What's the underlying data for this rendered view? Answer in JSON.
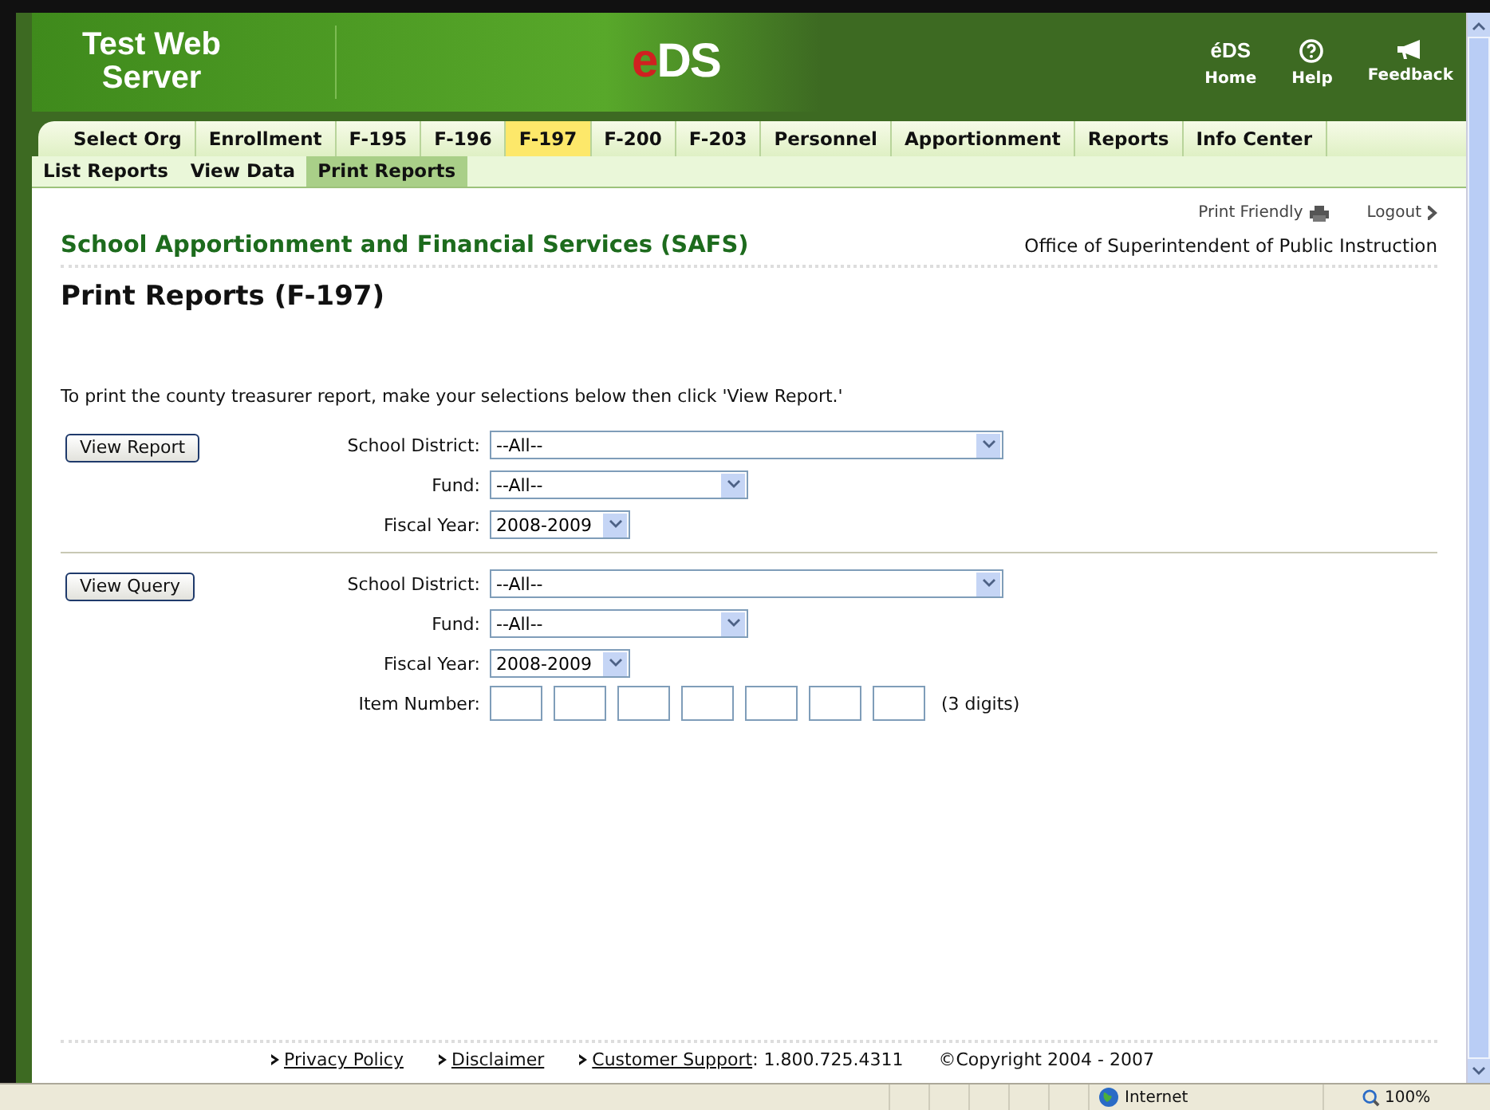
{
  "header": {
    "title": "Test Web Server",
    "logo": [
      "e",
      "DS"
    ],
    "links": [
      {
        "kind": "eds",
        "icon_text": "éDS",
        "label": "Home"
      },
      {
        "kind": "help",
        "label": "Help"
      },
      {
        "kind": "megaphone",
        "label": "Feedback"
      }
    ]
  },
  "tabs": [
    {
      "label": "Select Org",
      "selected": false
    },
    {
      "label": "Enrollment",
      "selected": false
    },
    {
      "label": "F-195",
      "selected": false
    },
    {
      "label": "F-196",
      "selected": false
    },
    {
      "label": "F-197",
      "selected": true
    },
    {
      "label": "F-200",
      "selected": false
    },
    {
      "label": "F-203",
      "selected": false
    },
    {
      "label": "Personnel",
      "selected": false
    },
    {
      "label": "Apportionment",
      "selected": false
    },
    {
      "label": "Reports",
      "selected": false
    },
    {
      "label": "Info Center",
      "selected": false
    }
  ],
  "subtabs": [
    {
      "label": "List Reports",
      "selected": false
    },
    {
      "label": "View Data",
      "selected": false
    },
    {
      "label": "Print Reports",
      "selected": true
    }
  ],
  "utility": {
    "print_friendly": "Print Friendly",
    "logout": "Logout"
  },
  "org_title": "School Apportionment and Financial Services (SAFS)",
  "office": "Office of Superintendent of Public Instruction",
  "page_title": "Print Reports (F-197)",
  "instructions": "To print the county treasurer report, make your selections below then click 'View Report.'",
  "sections": [
    {
      "button": "View Report",
      "fields": [
        {
          "kind": "select",
          "label": "School District:",
          "value": "--All--"
        },
        {
          "kind": "select",
          "label": "Fund:",
          "value": "--All--"
        },
        {
          "kind": "select",
          "label": "Fiscal Year:",
          "value": "2008-2009"
        }
      ]
    },
    {
      "button": "View Query",
      "fields": [
        {
          "kind": "select",
          "label": "School District:",
          "value": "--All--"
        },
        {
          "kind": "select",
          "label": "Fund:",
          "value": "--All--"
        },
        {
          "kind": "select",
          "label": "Fiscal Year:",
          "value": "2008-2009"
        },
        {
          "kind": "boxes",
          "label": "Item Number:",
          "note": "(3 digits)"
        }
      ]
    }
  ],
  "footer": [
    {
      "kind": "link",
      "label": "Privacy Policy"
    },
    {
      "kind": "link",
      "label": "Disclaimer"
    },
    {
      "kind": "link",
      "label": "Customer Support",
      "suffix": ": 1.800.725.4311"
    },
    {
      "kind": "text",
      "label": "©Copyright 2004 - 2007"
    }
  ],
  "status_bar": {
    "zone": "Internet",
    "zoom": "100%"
  }
}
